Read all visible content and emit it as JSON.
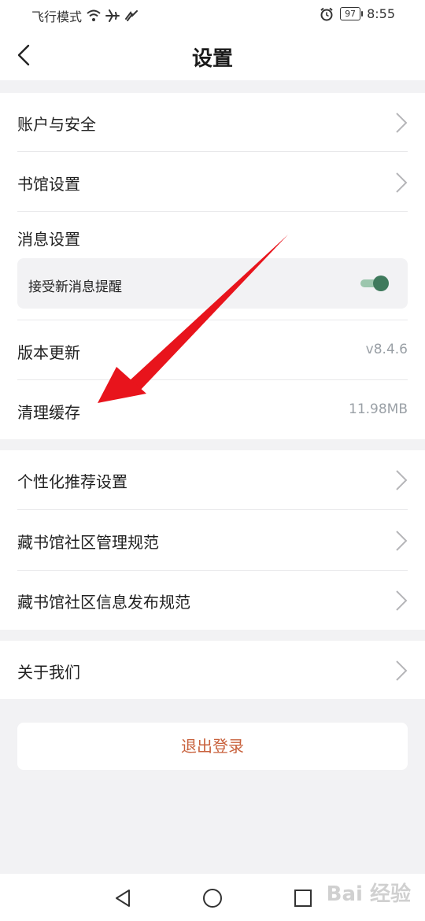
{
  "status_bar": {
    "mode_text": "飞行模式",
    "battery": "97",
    "time": "8:55"
  },
  "header": {
    "title": "设置"
  },
  "groups": {
    "account": {
      "items": [
        {
          "label": "账户与安全"
        },
        {
          "label": "书馆设置"
        }
      ],
      "message_settings": {
        "label": "消息设置",
        "notify_label": "接受新消息提醒",
        "notify_on": true
      },
      "version": {
        "label": "版本更新",
        "value": "v8.4.6"
      },
      "cache": {
        "label": "清理缓存",
        "value": "11.98MB"
      }
    },
    "community": {
      "items": [
        {
          "label": "个性化推荐设置"
        },
        {
          "label": "藏书馆社区管理规范"
        },
        {
          "label": "藏书馆社区信息发布规范"
        }
      ]
    },
    "about": {
      "items": [
        {
          "label": "关于我们"
        }
      ]
    }
  },
  "logout": {
    "label": "退出登录"
  },
  "watermark": {
    "text": "Bai 经验"
  },
  "colors": {
    "accent_logout": "#c8613c",
    "toggle_on": "#3f7a5c",
    "annotation_arrow": "#e8141c"
  }
}
